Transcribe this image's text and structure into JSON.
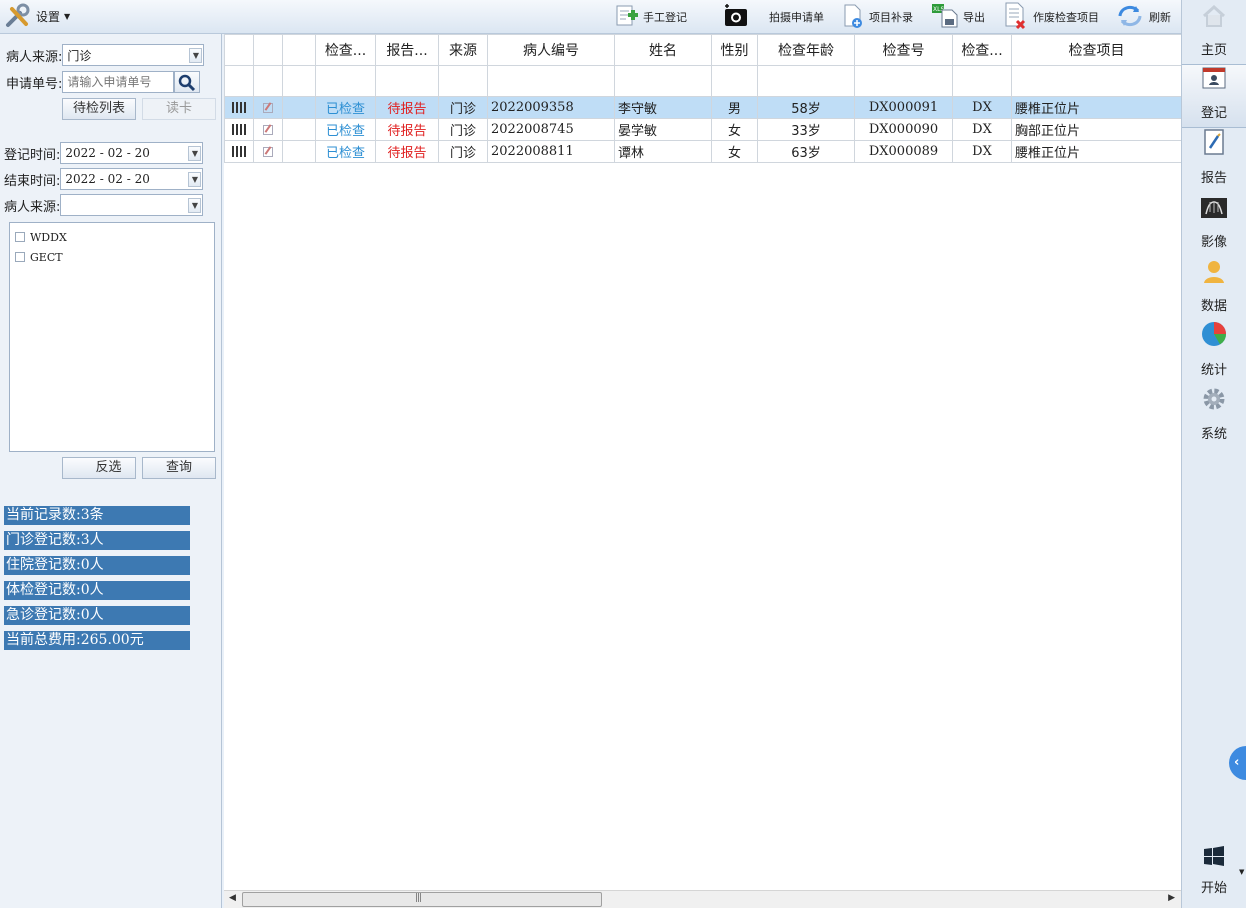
{
  "toolbar": {
    "settings_label": "设置",
    "tools": [
      {
        "label": "手工登记",
        "icon": "manual-register-icon"
      },
      {
        "label": "拍摄申请单",
        "icon": "camera-icon"
      },
      {
        "label": "项目补录",
        "icon": "add-document-icon"
      },
      {
        "label": "导出",
        "icon": "export-xls-icon"
      },
      {
        "label": "作废检查项目",
        "icon": "void-document-icon"
      },
      {
        "label": "刷新",
        "icon": "refresh-icon"
      }
    ]
  },
  "left_panel": {
    "source_label": "病人来源:",
    "source_value": "门诊",
    "request_label": "申请单号:",
    "request_placeholder": "请输入申请单号",
    "pending_list_button": "待检列表",
    "read_card_button": "读卡",
    "register_time_label": "登记时间:",
    "register_time_value": "2022 - 02 - 20",
    "end_time_label": "结束时间:",
    "end_time_value": "2022 - 02 - 20",
    "source2_label": "病人来源:",
    "source2_value": "",
    "device_items": [
      "WDDX",
      "GECT"
    ],
    "invert_button": "反选",
    "query_button": "查询",
    "stats": [
      "当前记录数:3条",
      "门诊登记数:3人",
      "住院登记数:0人",
      "体检登记数:0人",
      "急诊登记数:0人",
      "当前总费用:265.00元"
    ]
  },
  "grid": {
    "columns": [
      "",
      "",
      "",
      "检查...",
      "报告...",
      "来源",
      "病人编号",
      "姓名",
      "性别",
      "检查年龄",
      "检查号",
      "检查...",
      "检查项目"
    ],
    "rows": [
      {
        "exam_status": "已检查",
        "report_status": "待报告",
        "source": "门诊",
        "patient_id": "2022009358",
        "name": "李守敏",
        "sex": "男",
        "age": "58岁",
        "exam_no": "DX000091",
        "modality": "DX",
        "item": "腰椎正位片",
        "selected": true
      },
      {
        "exam_status": "已检查",
        "report_status": "待报告",
        "source": "门诊",
        "patient_id": "2022008745",
        "name": "晏学敏",
        "sex": "女",
        "age": "33岁",
        "exam_no": "DX000090",
        "modality": "DX",
        "item": "胸部正位片",
        "selected": false
      },
      {
        "exam_status": "已检查",
        "report_status": "待报告",
        "source": "门诊",
        "patient_id": "2022008811",
        "name": "谭林",
        "sex": "女",
        "age": "63岁",
        "exam_no": "DX000089",
        "modality": "DX",
        "item": "腰椎正位片",
        "selected": false
      }
    ]
  },
  "nav": {
    "items": [
      {
        "label": "主页",
        "icon": "home-icon"
      },
      {
        "label": "登记",
        "icon": "register-card-icon"
      },
      {
        "label": "报告",
        "icon": "report-icon"
      },
      {
        "label": "影像",
        "icon": "xray-image-icon"
      },
      {
        "label": "数据",
        "icon": "person-data-icon"
      },
      {
        "label": "统计",
        "icon": "pie-chart-icon"
      },
      {
        "label": "系统",
        "icon": "gear-icon"
      }
    ],
    "start_label": "开始"
  },
  "colors": {
    "accent": "#3d79b2",
    "selected_row": "#bfddf6",
    "status_checked": "#2d8fd3",
    "status_report": "#e02020"
  }
}
